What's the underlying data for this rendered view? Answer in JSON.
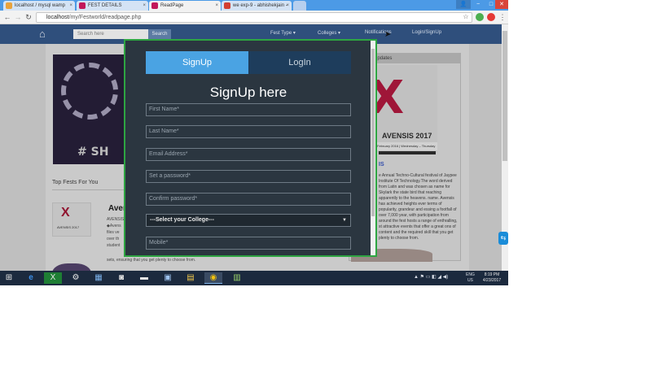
{
  "browser": {
    "tabs": [
      {
        "label": "localhost / mysql wamp",
        "favicon_color": "#e8a33d",
        "active": false
      },
      {
        "label": "FEST DETAILS",
        "favicon_color": "#c2185b",
        "active": false
      },
      {
        "label": "ReadPage",
        "favicon_color": "#c2185b",
        "active": true
      },
      {
        "label": "we exp-9 - abhishekjain -",
        "favicon_color": "#d23f31",
        "active": false
      }
    ],
    "url_host": "localhost",
    "url_path": "/my/Festworld/readpage.php",
    "back_glyph": "←",
    "forward_glyph": "→",
    "reload_glyph": "↻",
    "star_glyph": "☆",
    "win_user": "👤",
    "win_min": "−",
    "win_max": "□",
    "win_close": "✕"
  },
  "site_nav": {
    "home_glyph": "⌂",
    "search_placeholder": "Search here",
    "search_button": "Search",
    "fest_type": "Fest Type ▾",
    "colleges": "Colleges ▾",
    "notifications": "Notifications",
    "login_signup": "Login/SignUp"
  },
  "page": {
    "banner_tag": "# SH",
    "section_heading": "Top Fests For You",
    "fest_name": "Aven",
    "fest_thumb_logo": "X",
    "fest_thumb_sub": "AVENSIS 2017",
    "fest_text": "AVENSIS ◆Avens files ve over th student challen",
    "fest_text_tail": "sets, ensuring that you get plenty to choose from.",
    "updates_heading": "Updates",
    "poster_title": "AVENSIS 2017",
    "poster_dates": "February 2016 | Wednesday – Thursday",
    "updates_title": "IS",
    "updates_text": "e Annual Techno-Cultural festival of Jaypee Institute Of Technology.The word derived from Latin and was chosen as name for Skylark the state bird that reaching apparently to the heavens. name. Avensis has achieved heights ever terms of popularity, grandeur and essing a footfall of over 7,000 year, with participation from around the fest hosts a range of enthralling, st attractive events that offer a great ons of content and the required skill that you get plenty to choose from."
  },
  "modal": {
    "tab_signup": "SignUp",
    "tab_login": "LogIn",
    "title": "SignUp here",
    "placeholders": {
      "first_name": "First Name*",
      "last_name": "Last Name*",
      "email": "Email Address*",
      "password": "Set a password*",
      "confirm_password": "Confirm password*",
      "mobile": "Mobile*"
    },
    "college_select": "---Select your College---",
    "select_caret": "▼"
  },
  "taskbar": {
    "start_glyph": "⊞",
    "icons": [
      "e",
      "X",
      "⚙",
      "▦",
      "◙",
      "▬",
      "▣",
      "▤",
      "◉",
      "▥"
    ],
    "tray_glyphs": "▲ ⚑ ▭ ◧ ◢ ◀)",
    "lang": "ENG",
    "region": "US",
    "time": "8:19 PM",
    "date": "4/23/2017"
  }
}
